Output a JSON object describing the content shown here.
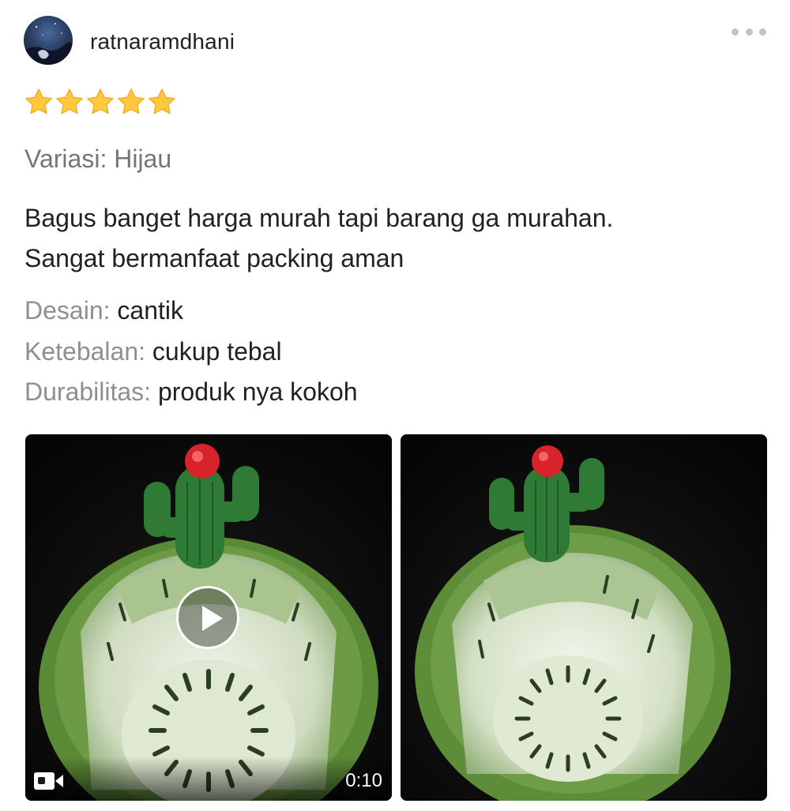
{
  "review": {
    "username": "ratnaramdhani",
    "rating": 5,
    "rating_max": 5,
    "variation": "Variasi: Hijau",
    "text_line1": "Bagus banget harga murah tapi barang ga murahan.",
    "text_line2": "Sangat bermanfaat packing aman",
    "attributes": [
      {
        "label": "Desain:",
        "value": "cantik"
      },
      {
        "label": "Ketebalan:",
        "value": "cukup tebal"
      },
      {
        "label": "Durabilitas:",
        "value": "produk nya kokoh"
      }
    ]
  },
  "media": {
    "video": {
      "duration": "0:10",
      "icon": "video-camera-icon",
      "play_icon": "play-icon"
    },
    "photo": {
      "icon": "photo"
    }
  },
  "icons": {
    "more": "more-horizontal-icon",
    "star": "star-icon"
  },
  "colors": {
    "star": "#FFC83D",
    "star_edge": "#F5A623",
    "text_primary": "#212121",
    "text_secondary": "#757575",
    "label_gray": "#8F8F8F",
    "product_green": "#5E8E3A",
    "cactus_red": "#D8232A"
  }
}
